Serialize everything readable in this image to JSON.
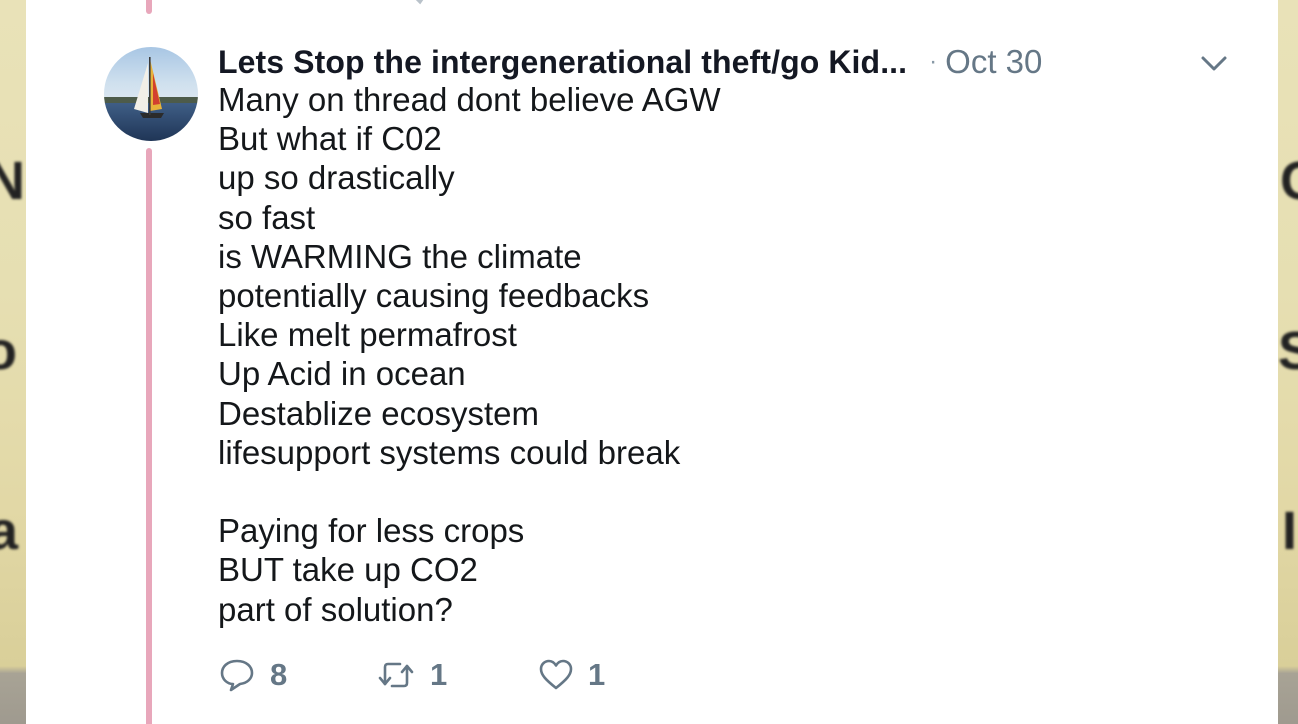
{
  "tweet": {
    "author": "Lets Stop the intergenerational theft/go Kid...",
    "separator": "·",
    "date": "Oct 30",
    "lines": [
      "Many on thread dont believe AGW",
      "But what if C02",
      "up so drastically",
      "so fast",
      "is WARMING the climate",
      "potentially causing feedbacks",
      "Like melt permafrost",
      "Up Acid in ocean",
      "Destablize ecosystem",
      "lifesupport systems could break",
      "",
      "Paying for less crops",
      "BUT take up CO2",
      "part of solution?"
    ],
    "actions": {
      "reply_count": "8",
      "retweet_count": "1",
      "like_count": "1"
    }
  },
  "colors": {
    "thread_line": "#e8a7bb",
    "muted": "#657786",
    "text": "#14171a"
  },
  "icons": {
    "menu": "chevron-down-icon",
    "reply": "reply-icon",
    "retweet": "retweet-icon",
    "like": "heart-icon"
  }
}
